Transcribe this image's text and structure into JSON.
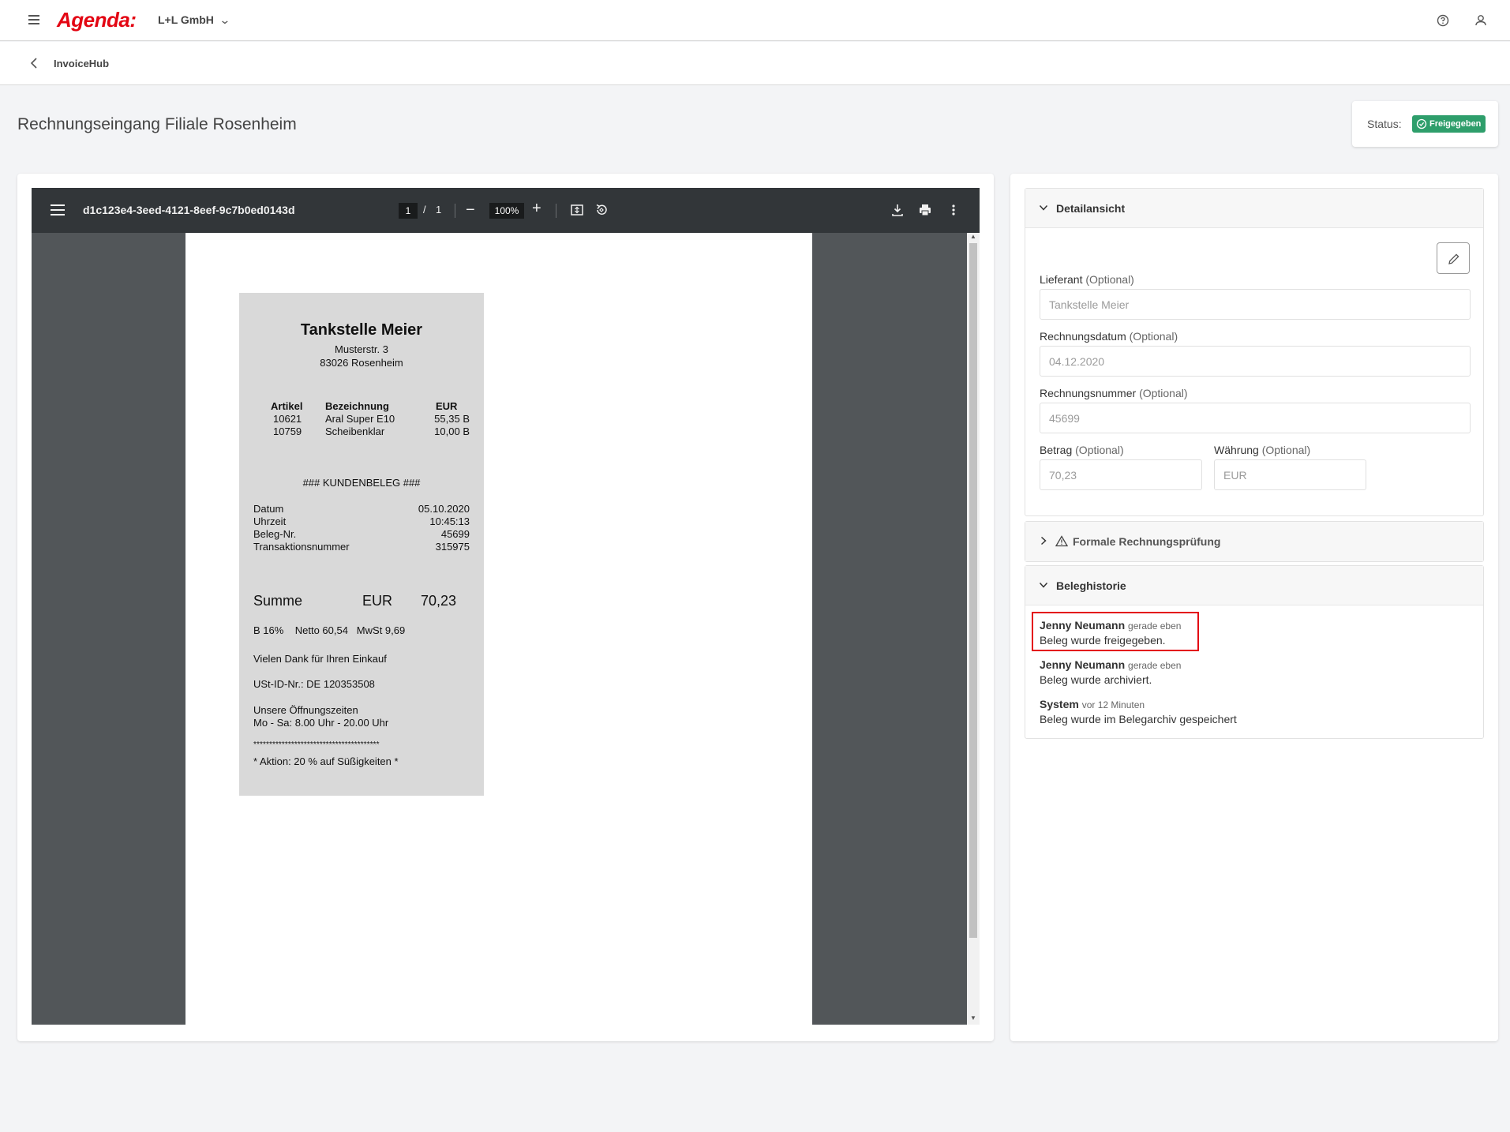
{
  "app": {
    "logo": "Agenda:",
    "company": "L+L GmbH"
  },
  "breadcrumb": {
    "label": "InvoiceHub"
  },
  "page": {
    "title": "Rechnungseingang Filiale Rosenheim",
    "status_label": "Status:",
    "status_value": "Freigegeben"
  },
  "pdf_viewer": {
    "filename": "d1c123e4-3eed-4121-8eef-9c7b0ed0143d",
    "current_page": "1",
    "page_separator": "/",
    "total_pages": "1",
    "zoom": "100%"
  },
  "receipt": {
    "store": "Tankstelle Meier",
    "street": "Musterstr. 3",
    "city": "83026 Rosenheim",
    "col_artikel": "Artikel",
    "col_bezeichnung": "Bezeichnung",
    "col_eur": "EUR",
    "items": [
      {
        "artikel": "10621",
        "bezeichnung": "Aral Super E10",
        "eur": "55,35 B"
      },
      {
        "artikel": "10759",
        "bezeichnung": "Scheibenklar",
        "eur": "10,00 B"
      }
    ],
    "kundenbeleg": "### KUNDENBELEG ###",
    "meta": [
      {
        "label": "Datum",
        "value": "05.10.2020"
      },
      {
        "label": "Uhrzeit",
        "value": "10:45:13"
      },
      {
        "label": "Beleg-Nr.",
        "value": "45699"
      },
      {
        "label": "Transaktionsnummer",
        "value": "315975"
      }
    ],
    "sum_label": "Summe",
    "sum_currency": "EUR",
    "sum_value": "70,23",
    "tax_line": "B 16%    Netto 60,54   MwSt 9,69",
    "thanks": "Vielen Dank für Ihren Einkauf",
    "vat_id": "USt-ID-Nr.: DE 120353508",
    "hours_title": "Unsere Öffnungszeiten",
    "hours": "Mo - Sa: 8.00 Uhr - 20.00 Uhr",
    "stars": "****************************************",
    "promo": "* Aktion: 20 % auf Süßigkeiten *"
  },
  "detail": {
    "section_title": "Detailansicht",
    "optional": "(Optional)",
    "fields": {
      "lieferant": {
        "label": "Lieferant",
        "value": "Tankstelle Meier"
      },
      "rechnungsdatum": {
        "label": "Rechnungsdatum",
        "value": "04.12.2020"
      },
      "rechnungsnummer": {
        "label": "Rechnungsnummer",
        "value": "45699"
      },
      "betrag": {
        "label": "Betrag",
        "value": "70,23"
      },
      "waehrung": {
        "label": "Währung",
        "value": "EUR"
      }
    }
  },
  "pruefung": {
    "section_title": "Formale Rechnungsprüfung"
  },
  "historie": {
    "section_title": "Beleghistorie",
    "entries": [
      {
        "name": "Jenny Neumann",
        "when": "gerade eben",
        "message": "Beleg wurde freigegeben."
      },
      {
        "name": "Jenny Neumann",
        "when": "gerade eben",
        "message": "Beleg wurde archiviert."
      },
      {
        "name": "System",
        "when": "vor 12 Minuten",
        "message": "Beleg wurde im Belegarchiv gespeichert"
      }
    ]
  },
  "colors": {
    "brand": "#e30613",
    "status_green": "#2e9e6b",
    "pdf_toolbar": "#323639",
    "pdf_background": "#525659"
  }
}
